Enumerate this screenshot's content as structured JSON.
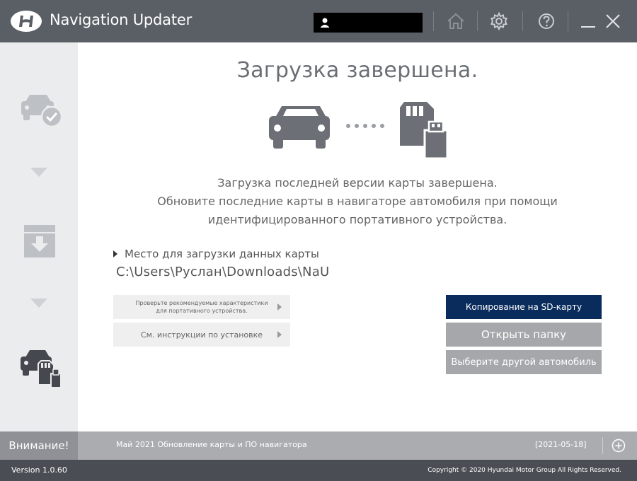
{
  "window": {
    "title": "Navigation Updater",
    "controls": {
      "home_icon": "home-icon",
      "settings_icon": "gear-icon",
      "help_icon": "help-icon",
      "minimize_icon": "minimize-icon",
      "close_icon": "close-icon"
    },
    "user_icon": "user-icon"
  },
  "sidebar": {
    "steps": [
      {
        "icon": "car-check-icon",
        "state": "done"
      },
      {
        "icon": "download-box-icon",
        "state": "done"
      },
      {
        "icon": "car-sd-card-icon",
        "state": "active"
      }
    ]
  },
  "main": {
    "heading": "Загрузка завершена.",
    "description": [
      "Загрузка последней версии карты завершена.",
      "Обновите последние карты в навигаторе автомобиля при помощи",
      "идентифицированного портативного устройства."
    ],
    "location_label": "Место для загрузки данных карты",
    "location_path": "C:\\Users\\Руслан\\Downloads\\NaU",
    "links": {
      "specs": [
        "Проверьте рекомендуемые характеристики",
        "для портативного устройства."
      ],
      "install": "См. инструкции по установке"
    },
    "actions": {
      "copy_sd": "Копирование на SD-карту",
      "open_folder": "Открыть папку",
      "choose_car": "Выберите другой автомобиль"
    }
  },
  "notice": {
    "label": "Внимание!",
    "text": "Май 2021 Обновление карты и ПО навигатора",
    "date": "[2021-05-18]"
  },
  "footer": {
    "version": "Version 1.0.60",
    "copyright": "Copyright © 2020 Hyundai Motor Group All Rights Reserved."
  },
  "colors": {
    "titlebar": "#5a5f66",
    "primary_button": "#0a2c5c",
    "secondary_button": "#a5a7aa",
    "notice_bar": "#aaacaf",
    "footer": "#4a4e54"
  }
}
